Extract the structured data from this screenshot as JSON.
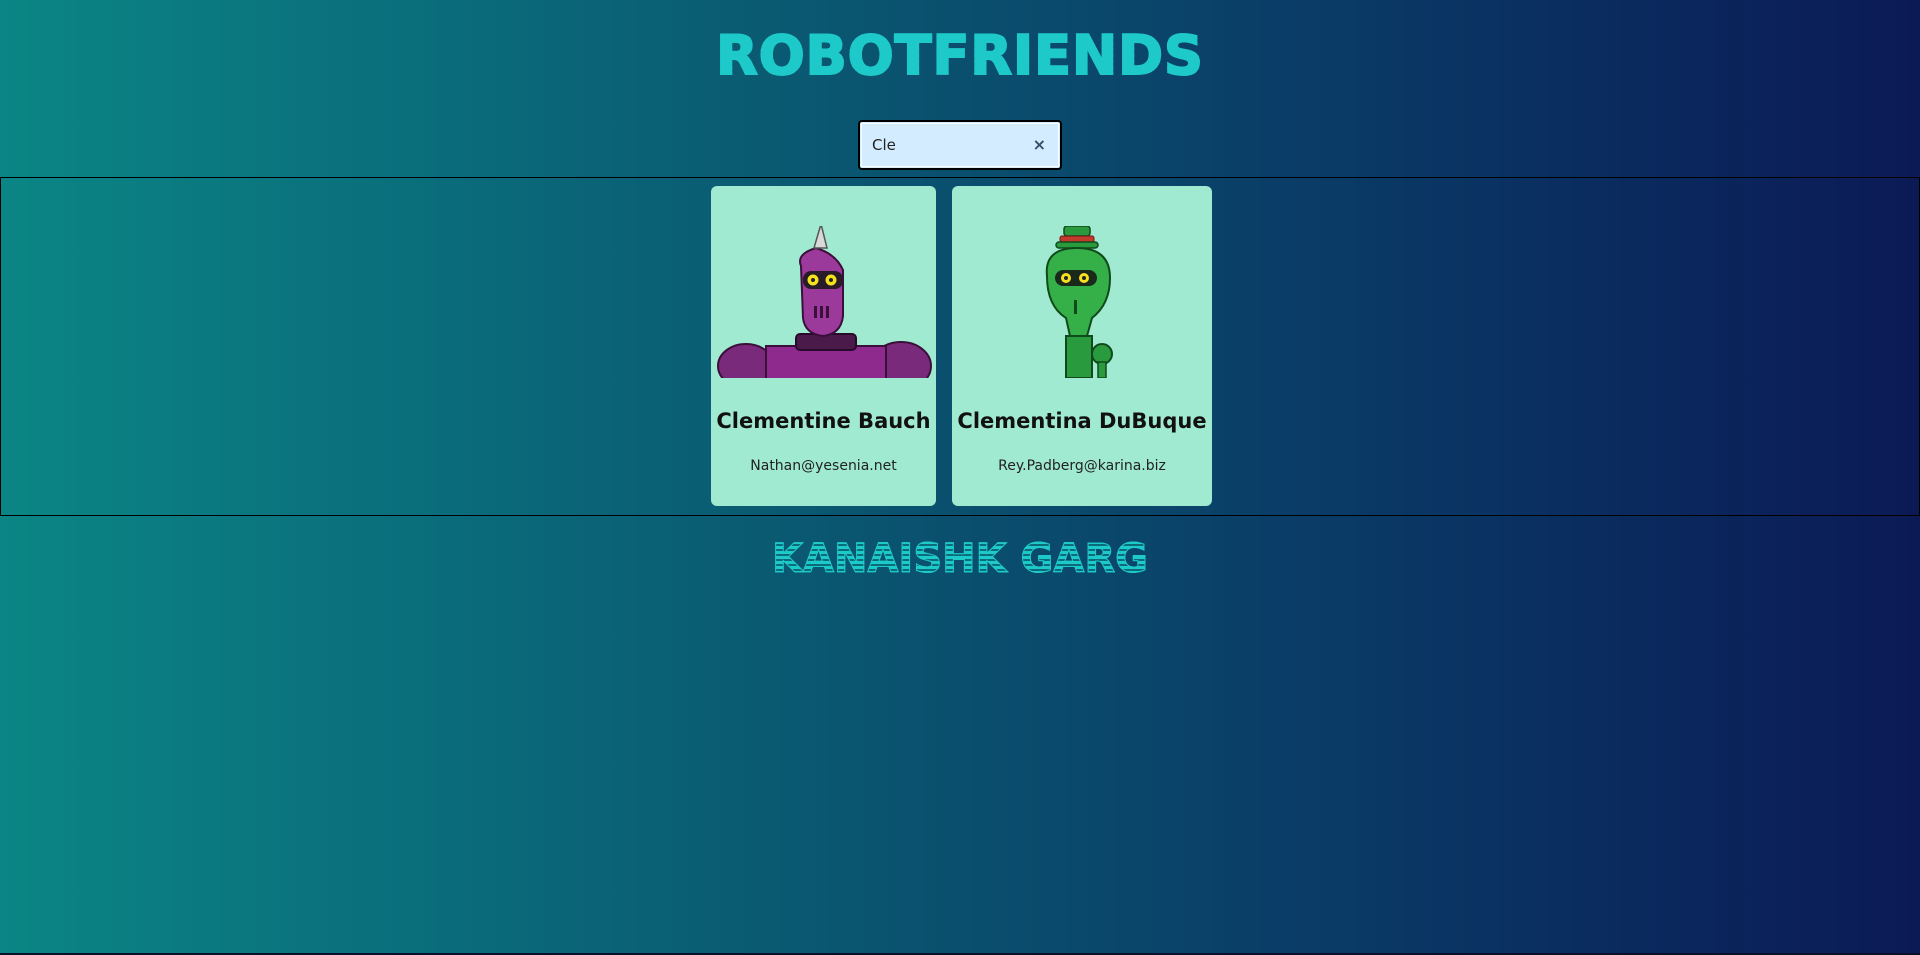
{
  "app": {
    "title": "ROBOTFRIENDS",
    "footer": "KANAISHK GARG"
  },
  "search": {
    "value": "Cle",
    "clear_glyph": "×"
  },
  "robots": [
    {
      "name": "Clementine Bauch",
      "email": "Nathan@yesenia.net",
      "image": "purple-robot-avatar",
      "color": "#8e2a8e"
    },
    {
      "name": "Clementina DuBuque",
      "email": "Rey.Padberg@karina.biz",
      "image": "green-robot-avatar",
      "color": "#2a9a3e"
    }
  ],
  "colors": {
    "accent": "#1ec9c9",
    "card_bg": "#a0ead2",
    "search_bg": "#d3ecff"
  }
}
